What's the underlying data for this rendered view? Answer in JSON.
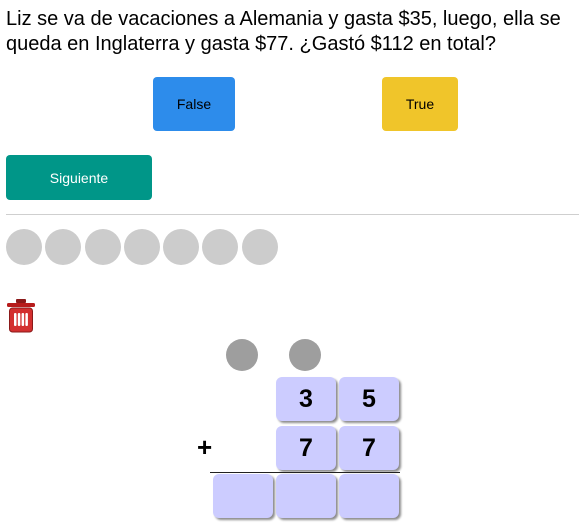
{
  "question": "Liz se va de vacaciones a Alemania y gasta $35, luego, ella se queda en Inglaterra y gasta $77. ¿Gastó $112 en total?",
  "answers": {
    "false_label": "False",
    "true_label": "True"
  },
  "next_label": "Siguiente",
  "progress": {
    "total": 7,
    "completed": 0
  },
  "problem": {
    "operator": "+",
    "top": [
      "3",
      "5"
    ],
    "bottom": [
      "7",
      "7"
    ],
    "result": [
      "",
      "",
      ""
    ]
  },
  "colors": {
    "false_button": "#2d8ceb",
    "true_button": "#f0c52a",
    "next_button": "#009688",
    "digit_cell": "#ccccff",
    "progress_dot": "#cccccc",
    "carry_dot": "#9e9e9e",
    "trash": "#d32f2f"
  },
  "icons": {
    "trash": "trash-icon"
  }
}
